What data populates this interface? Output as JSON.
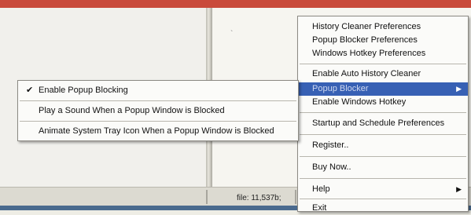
{
  "status": {
    "file_info": "file: 11,537b;"
  },
  "main_menu": {
    "items": [
      {
        "label": "History Cleaner Preferences"
      },
      {
        "label": "Popup Blocker Preferences"
      },
      {
        "label": "Windows Hotkey Preferences"
      },
      {
        "label": "Enable Auto History Cleaner"
      },
      {
        "label": "Popup Blocker"
      },
      {
        "label": "Enable Windows Hotkey"
      },
      {
        "label": "Startup and Schedule Preferences"
      },
      {
        "label": "Register.."
      },
      {
        "label": "Buy Now.."
      },
      {
        "label": "Help"
      },
      {
        "label": "Exit"
      }
    ]
  },
  "popup_submenu": {
    "items": [
      {
        "label": "Enable Popup Blocking",
        "checked": true
      },
      {
        "label": "Play a Sound When a Popup Window is Blocked"
      },
      {
        "label": "Animate System Tray Icon When a Popup Window is Blocked"
      }
    ]
  },
  "icons": {
    "check": "check-icon",
    "submenu_arrow": "arrow-right-icon"
  },
  "colors": {
    "highlight": "#3760b4",
    "title_bar": "#c94a3b"
  }
}
